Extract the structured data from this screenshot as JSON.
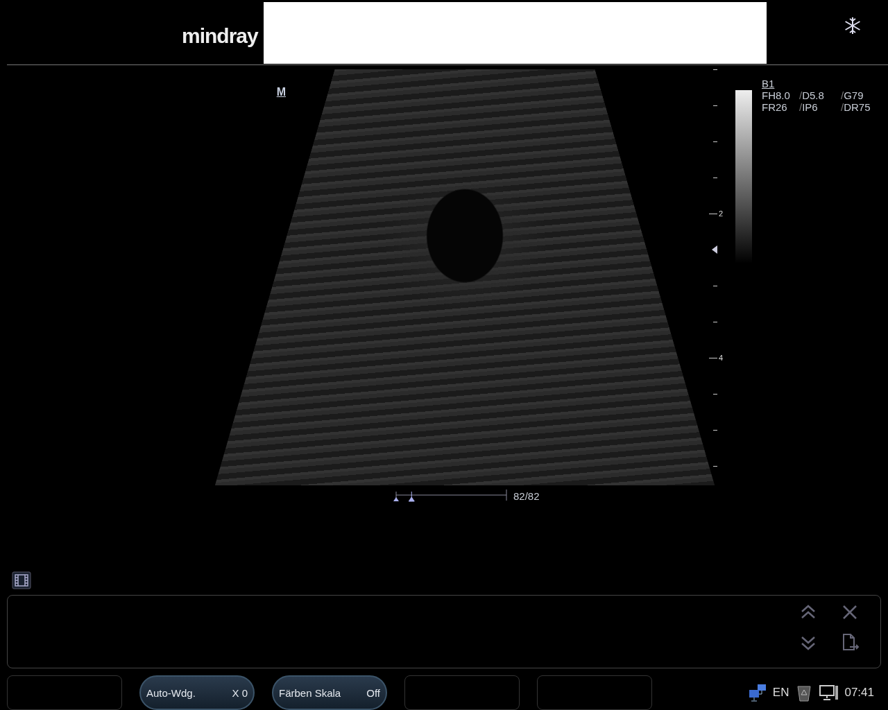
{
  "header": {
    "logo": "mindray",
    "frozen": true
  },
  "image": {
    "mode_label": "M",
    "params_title": "B1",
    "params": [
      [
        {
          "text": "FH8.0"
        },
        {
          "sep": "/",
          "text": "D5.8"
        },
        {
          "sep": "/",
          "text": "G79"
        }
      ],
      [
        {
          "text": "FR26"
        },
        {
          "sep": "/",
          "text": "IP6"
        },
        {
          "sep": "/",
          "text": "DR75"
        }
      ]
    ],
    "depth_ticks": [
      {
        "kind": "minor"
      },
      {
        "kind": "minor"
      },
      {
        "kind": "minor"
      },
      {
        "kind": "minor"
      },
      {
        "kind": "major",
        "label": "2"
      },
      {
        "kind": "focus"
      },
      {
        "kind": "minor"
      },
      {
        "kind": "minor"
      },
      {
        "kind": "major",
        "label": "4"
      },
      {
        "kind": "minor"
      },
      {
        "kind": "minor"
      },
      {
        "kind": "minor"
      }
    ],
    "cine": {
      "level": 0.14,
      "frames": "82/82"
    }
  },
  "soft_buttons": [
    {
      "kind": "empty"
    },
    {
      "kind": "button",
      "label": "Auto-Wdg.",
      "value": "X 0"
    },
    {
      "kind": "button",
      "label": "Färben Skala",
      "value": "Off"
    },
    {
      "kind": "empty"
    },
    {
      "kind": "empty"
    }
  ],
  "status_bar": {
    "language": "EN",
    "time": "07:41"
  }
}
